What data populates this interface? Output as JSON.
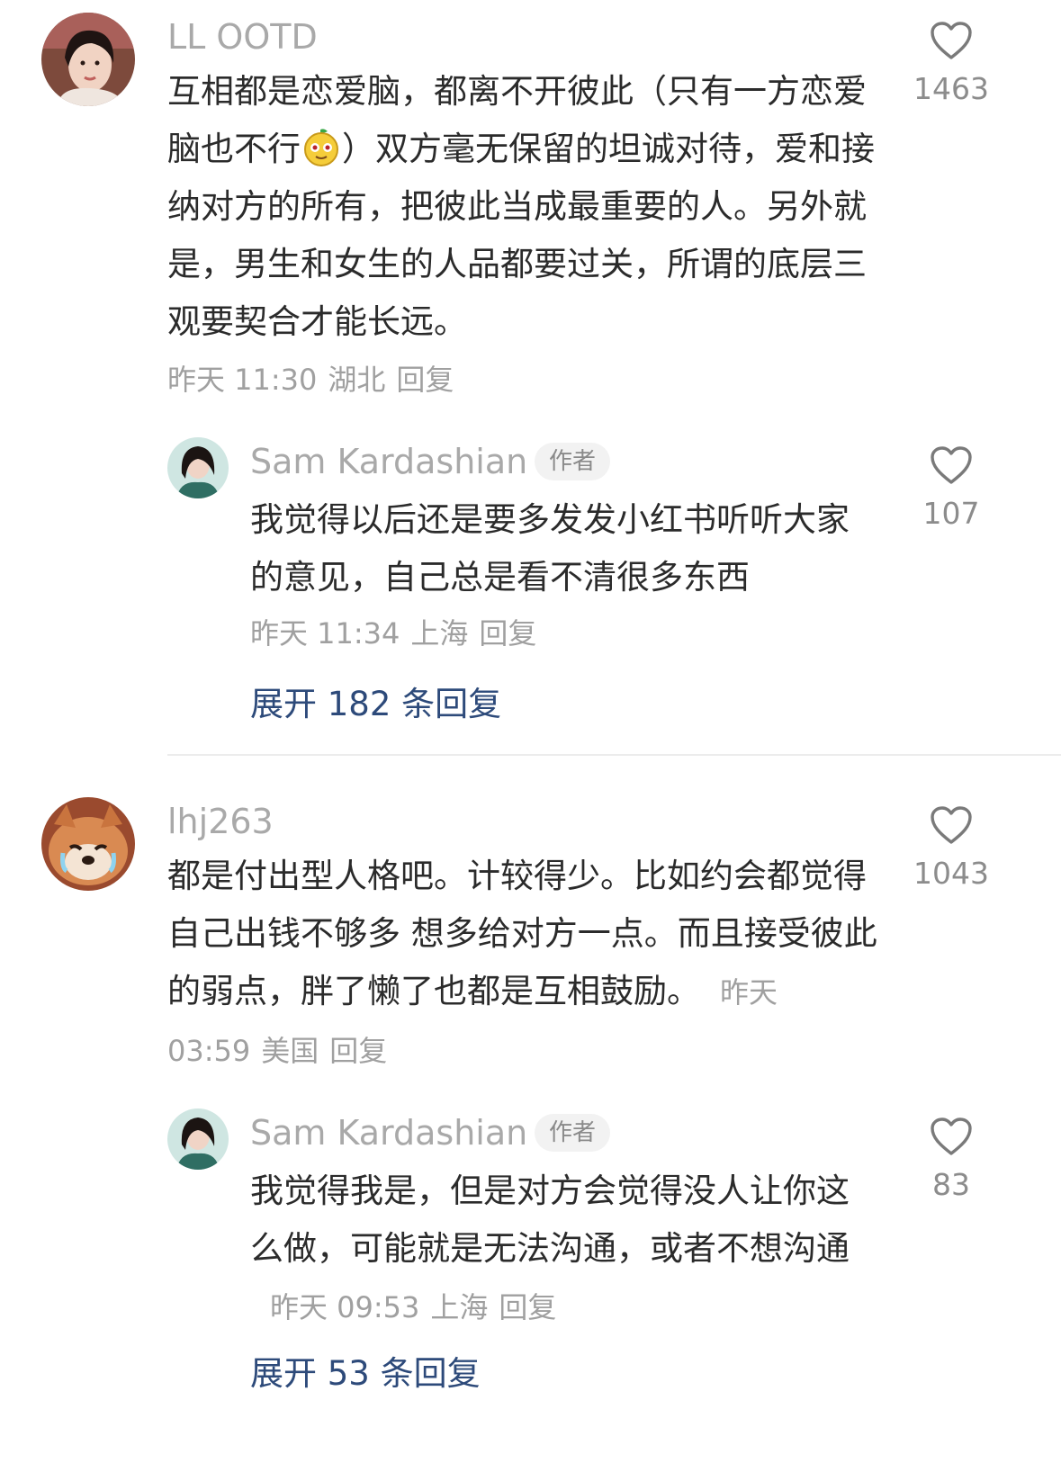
{
  "comments": [
    {
      "username": "LL OOTD",
      "text_parts": [
        "互相都是恋爱脑，都离不开彼此（只有一方恋爱脑也不行",
        "）双方毫无保留的坦诚对待，爱和接纳对方的所有，把彼此当成最重要的人。另外就是，男生和女生的人品都要过关，所谓的底层三观要契合才能长远。"
      ],
      "emoji": "smiling-fruit-emoji",
      "time": "昨天 11:30",
      "location": "湖北",
      "reply_label": "回复",
      "likes": "1463",
      "reply": {
        "username": "Sam Kardashian",
        "badge": "作者",
        "text": "我觉得以后还是要多发发小红书听听大家的意见，自己总是看不清很多东西",
        "time": "昨天 11:34",
        "location": "上海",
        "reply_label": "回复",
        "likes": "107"
      },
      "expand_label": "展开 182 条回复"
    },
    {
      "username": "lhj263",
      "text": "都是付出型人格吧。计较得少。比如约会都觉得自己出钱不够多 想多给对方一点。而且接受彼此的弱点，胖了懒了也都是互相鼓励。",
      "time": "昨天 03:59",
      "location": "美国",
      "reply_label": "回复",
      "likes": "1043",
      "reply": {
        "username": "Sam Kardashian",
        "badge": "作者",
        "text": "我觉得我是，但是对方会觉得没人让你这么做，可能就是无法沟通，或者不想沟通",
        "time": "昨天 09:53",
        "location": "上海",
        "reply_label": "回复",
        "likes": "83"
      },
      "expand_label": "展开 53 条回复"
    }
  ],
  "colors": {
    "username": "#a9a9a9",
    "text": "#2b2b2b",
    "meta": "#a0a0a0",
    "expand_link": "#2d4a7a",
    "badge_bg": "#f2f2f2"
  },
  "icons": {
    "like": "heart-outline-icon"
  }
}
